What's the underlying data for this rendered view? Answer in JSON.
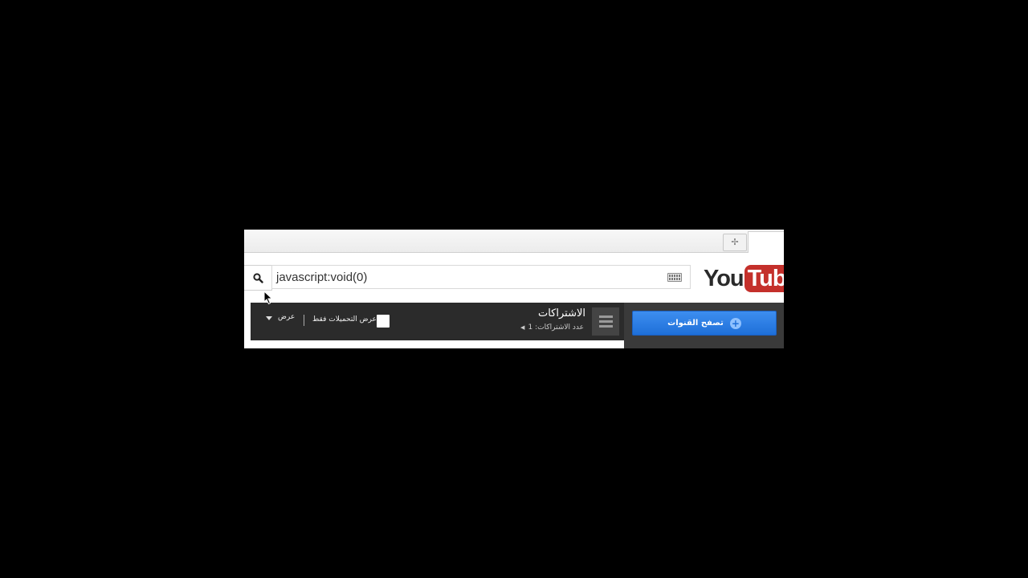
{
  "browser": {
    "new_tab_icon": "new-tab-icon"
  },
  "search": {
    "value": "javascript:void(0)",
    "search_icon": "search-icon",
    "keyboard_icon": "keyboard-icon"
  },
  "logo": {
    "part1": "You",
    "part2": "Tube"
  },
  "browse": {
    "label": "تصفح القنوات",
    "icon": "plus-circle-icon"
  },
  "subscriptions": {
    "title": "الاشتراكات",
    "count_text": "عدد الاشتراكات: 1",
    "uploads_only_label": "عرض التحميلات فقط",
    "view_label": "عرض"
  },
  "colors": {
    "accent_blue": "#1e6fd8",
    "logo_red": "#c4302b",
    "bar_dark": "#2b2b2b"
  }
}
